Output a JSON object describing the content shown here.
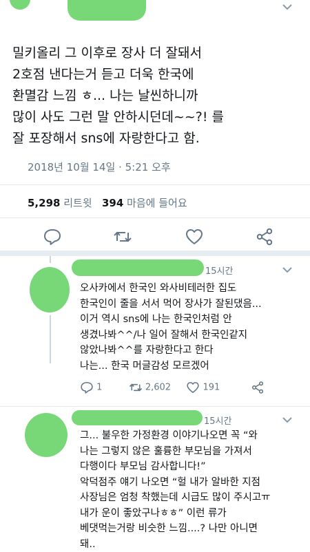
{
  "tweet": {
    "lines": [
      "밀키올리 그 이후로 장사 더 잘돼서",
      "2호점 낸다는거 듣고 더욱 한국에",
      "환멸감 느낌 ㅎ...  나는 날씬하니까",
      "많이 사도 그런 말 안하시던데~~?! 를",
      "잘 포장해서 sns에 자랑한다고 함."
    ],
    "date": "2018년 10월 14일",
    "separator": "·",
    "time": "5:21 오후",
    "retweet_count": "5,298",
    "retweet_label": "리트윗",
    "like_count": "394",
    "like_label": "마음에 들어요",
    "icons": [
      "reply-icon",
      "retweet-icon",
      "heart-icon",
      "share-icon"
    ]
  },
  "replies": [
    {
      "time": "15시간",
      "lines": [
        "오사카에서 한국인 와사비테러한 집도",
        "한국인이 줄을 서서 먹어 장사가 잘된댔음...",
        "이거 역시 sns에 나는 한국인처럼 안",
        "생겼나봐^^/나 일어 잘해서 한국인같지",
        "않았나봐^^를 자랑한다고 한다",
        "나는... 한국 머글감성 모르겠어"
      ],
      "reply_count": "1",
      "retweet_count": "2,602",
      "like_count": "191"
    },
    {
      "time": "15시간",
      "lines": [
        "그... 불우한 가정환경 이야기나오면 꼭 “와",
        "나는 그렇지 않은 훌륭한 부모님을 가져서",
        "다행이다 부모님 감사합니다!”",
        "악덕점주 얘기 나오면 “헐 내가 알바한 지점",
        "사장님은 엄청 착했는데 시급도 많이 주시고ㅠ",
        "내가 운이 좋았구나ㅎㅎ” 이런 류가",
        "베댓먹는거랑 비슷한 느낌....? 나만 아니면",
        "돼.."
      ]
    }
  ],
  "colors": {
    "redaction": "#78d878",
    "text": "#14171a",
    "secondary": "#657786",
    "divider": "#e1e8ed"
  }
}
